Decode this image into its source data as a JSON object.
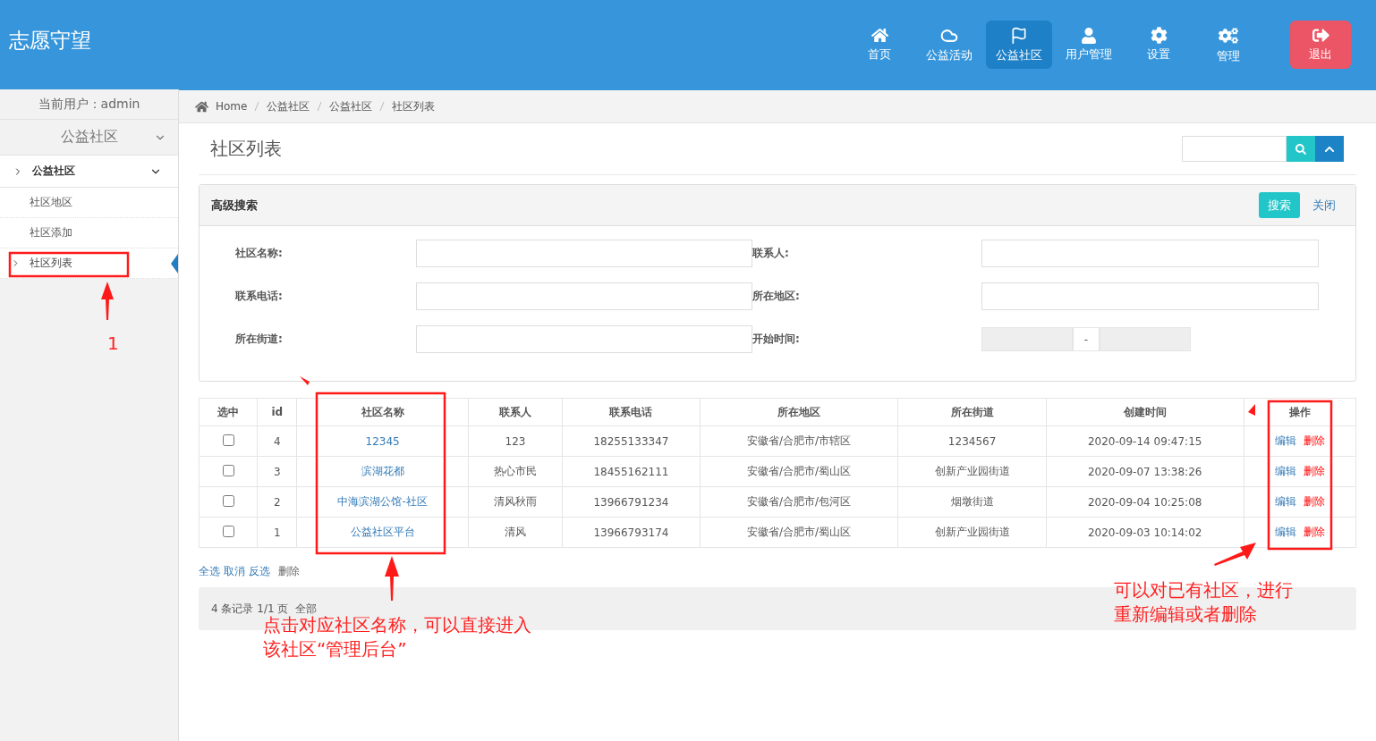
{
  "header": {
    "title": "志愿守望",
    "nav": [
      {
        "label": "首页",
        "kind": "normal",
        "selected": false
      },
      {
        "label": "公益活动",
        "kind": "normal",
        "selected": false
      },
      {
        "label": "公益社区",
        "kind": "normal",
        "selected": true
      },
      {
        "label": "用户管理",
        "kind": "normal",
        "selected": false
      },
      {
        "label": "设置",
        "kind": "normal",
        "selected": false
      },
      {
        "label": "管理",
        "kind": "normal",
        "selected": false
      },
      {
        "label": "退出",
        "kind": "danger",
        "selected": false
      }
    ]
  },
  "sidebar": {
    "current_user": "当前用户：admin",
    "section": "公益社区",
    "group": "公益社区",
    "items": [
      {
        "label": "社区地区",
        "selected": false
      },
      {
        "label": "社区添加",
        "selected": false
      },
      {
        "label": "社区列表",
        "selected": true
      }
    ]
  },
  "breadcrumb": [
    "Home",
    "公益社区",
    "公益社区",
    "社区列表"
  ],
  "page_title": "社区列表",
  "advanced_search": {
    "title": "高级搜索",
    "search_button": "搜索",
    "close_link": "关闭",
    "fields": [
      {
        "label": "社区名称:",
        "kind": "text"
      },
      {
        "label": "联系人:",
        "kind": "text"
      },
      {
        "label": "联系电话:",
        "kind": "text"
      },
      {
        "label": "所在地区:",
        "kind": "text"
      },
      {
        "label": "所在街道:",
        "kind": "text"
      },
      {
        "label": "开始时间:",
        "kind": "daterange",
        "separator": "-"
      }
    ]
  },
  "table": {
    "columns": [
      "选中",
      "id",
      "社区名称",
      "联系人",
      "联系电话",
      "所在地区",
      "所在街道",
      "创建时间",
      "操作"
    ],
    "rows": [
      {
        "checked": false,
        "id": "4",
        "name": "12345",
        "contact": "123",
        "phone": "18255133347",
        "region": "安徽省/合肥市/市辖区",
        "street": "1234567",
        "created": "2020-09-14 09:47:15",
        "edit": "编辑",
        "delete": "删除"
      },
      {
        "checked": false,
        "id": "3",
        "name": "滨湖花都",
        "contact": "热心市民",
        "phone": "18455162111",
        "region": "安徽省/合肥市/蜀山区",
        "street": "创新产业园街道",
        "created": "2020-09-07 13:38:26",
        "edit": "编辑",
        "delete": "删除"
      },
      {
        "checked": false,
        "id": "2",
        "name": "中海滨湖公馆-社区",
        "contact": "清风秋雨",
        "phone": "13966791234",
        "region": "安徽省/合肥市/包河区",
        "street": "烟墩街道",
        "created": "2020-09-04 10:25:08",
        "edit": "编辑",
        "delete": "删除"
      },
      {
        "checked": false,
        "id": "1",
        "name": "公益社区平台",
        "contact": "清风",
        "phone": "13966793174",
        "region": "安徽省/合肥市/蜀山区",
        "street": "创新产业园街道",
        "created": "2020-09-03 10:14:02",
        "edit": "编辑",
        "delete": "删除"
      }
    ]
  },
  "bulk_actions": [
    "全选",
    "取消",
    "反选",
    "删除"
  ],
  "pagination": {
    "summary": "4 条记录 1/1 页",
    "all": "全部"
  },
  "annotations": [
    {
      "lines": [
        "1"
      ]
    },
    {
      "lines": [
        "点击对应社区名称，可以直接进入",
        "该社区“管理后台”"
      ]
    },
    {
      "lines": [
        "可以对已有社区，进行",
        "重新编辑或者删除"
      ]
    }
  ]
}
